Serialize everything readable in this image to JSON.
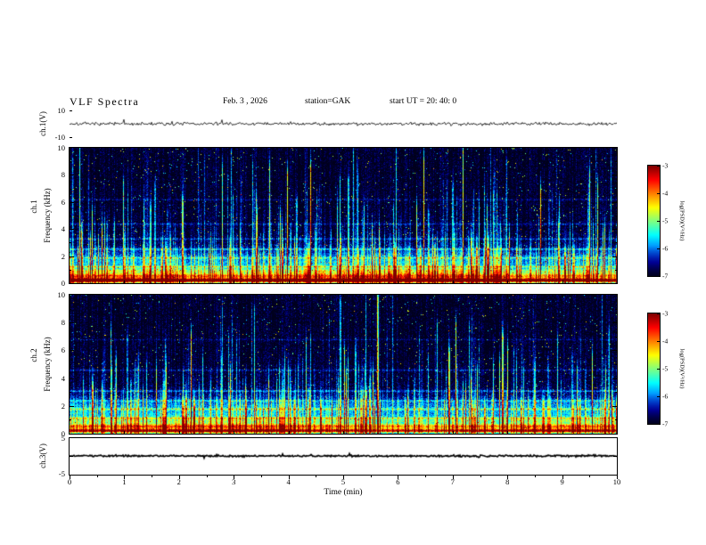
{
  "header": {
    "title": "VLF  Spectra",
    "date": "Feb. 3  , 2026",
    "station": "station=GAK",
    "start_ut": "start UT  =   20: 40: 0"
  },
  "xaxis": {
    "label": "Time  (min)",
    "range": [
      0,
      10
    ],
    "ticks": [
      0,
      1,
      2,
      3,
      4,
      5,
      6,
      7,
      8,
      9,
      10
    ]
  },
  "colorbar": {
    "label": "log(PSD)(V²/Hz)",
    "ticks": [
      -3,
      -4,
      -5,
      -6,
      -7
    ],
    "range": [
      -7,
      -3
    ]
  },
  "chart_data": [
    {
      "type": "line",
      "name": "ch1_waveform",
      "ylabel": "ch.1(V)",
      "ylim": [
        -10,
        10
      ],
      "yticks": [
        10,
        -10
      ],
      "sim": {
        "seed": 7,
        "amplitude": 1.8
      }
    },
    {
      "type": "heatmap",
      "name": "ch1_spectrogram",
      "ylabel_channel": "ch.1",
      "ylabel": "Frequency  (kHz)",
      "ylim": [
        0,
        10
      ],
      "yticks": [
        0,
        2,
        4,
        6,
        8,
        10
      ],
      "value_range": [
        -7,
        -3
      ],
      "sim": {
        "seed": 21,
        "streaks": 340,
        "base": 1.5,
        "baseScale": 1.4,
        "bands": [
          {
            "f": 0.25,
            "amp": 3.4,
            "w": 0.1
          },
          {
            "f": 0.55,
            "amp": 1.8,
            "w": 0.12
          },
          {
            "f": 0.9,
            "amp": 1.1,
            "w": 0.18
          },
          {
            "f": 1.7,
            "amp": 0.7,
            "w": 0.55
          }
        ],
        "hlines": [
          {
            "f": 1.25,
            "amp": 0.9,
            "w": 0.05
          },
          {
            "f": 1.9,
            "amp": 0.7,
            "w": 0.05
          },
          {
            "f": 2.55,
            "amp": 0.8,
            "w": 0.05
          },
          {
            "f": 3.3,
            "amp": 0.6,
            "w": 0.05
          },
          {
            "f": 4.4,
            "amp": 0.5,
            "w": 0.05
          },
          {
            "f": 6.2,
            "amp": 0.4,
            "w": 0.05
          }
        ]
      }
    },
    {
      "type": "heatmap",
      "name": "ch2_spectrogram",
      "ylabel_channel": "ch.2",
      "ylabel": "Frequency  (kHz)",
      "ylim": [
        0,
        10
      ],
      "yticks": [
        0,
        2,
        4,
        6,
        8,
        10
      ],
      "value_range": [
        -7,
        -3
      ],
      "sim": {
        "seed": 37,
        "streaks": 300,
        "base": 1.3,
        "baseScale": 1.5,
        "bands": [
          {
            "f": 0.25,
            "amp": 2.7,
            "w": 0.09
          },
          {
            "f": 0.55,
            "amp": 1.9,
            "w": 0.12
          },
          {
            "f": 0.95,
            "amp": 0.9,
            "w": 0.2
          },
          {
            "f": 1.8,
            "amp": 0.8,
            "w": 0.6
          }
        ],
        "hlines": [
          {
            "f": 1.15,
            "amp": 0.8,
            "w": 0.05
          },
          {
            "f": 1.8,
            "amp": 0.8,
            "w": 0.05
          },
          {
            "f": 2.4,
            "amp": 0.6,
            "w": 0.05
          },
          {
            "f": 3.1,
            "amp": 0.7,
            "w": 0.05
          },
          {
            "f": 4.6,
            "amp": 0.5,
            "w": 0.05
          },
          {
            "f": 6.8,
            "amp": 0.35,
            "w": 0.05
          }
        ]
      }
    },
    {
      "type": "line",
      "name": "ch3_waveform",
      "ylabel": "ch.3(V)",
      "ylim": [
        -5,
        5
      ],
      "yticks": [
        5,
        -5
      ],
      "sim": {
        "seed": 9,
        "amplitude": 0.4
      }
    }
  ]
}
